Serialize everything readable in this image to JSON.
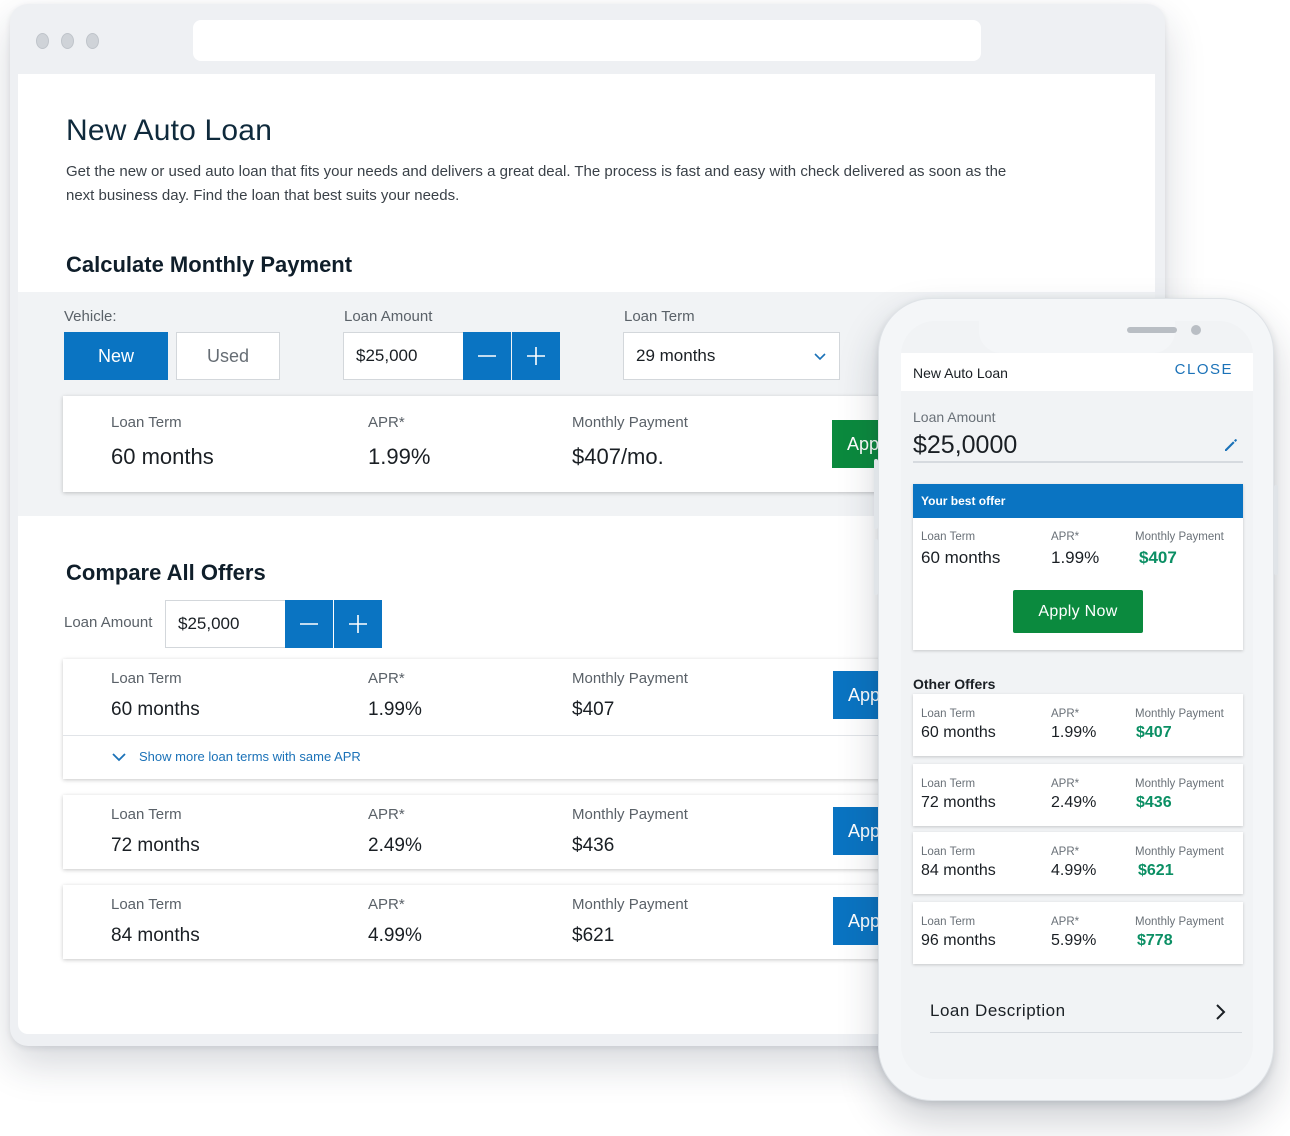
{
  "desktop": {
    "title": "New Auto Loan",
    "description": "Get the new or used auto loan that fits your needs and delivers a great deal. The process is fast and easy with check delivered as soon as the next business day. Find the loan that best suits your needs.",
    "calculator": {
      "heading": "Calculate Monthly Payment",
      "vehicle_label": "Vehicle:",
      "vehicle_options": [
        "New",
        "Used"
      ],
      "vehicle_selected": "New",
      "loan_amount_label": "Loan Amount",
      "loan_amount_value": "$25,000",
      "loan_term_label": "Loan Term",
      "loan_term_value": "29 months",
      "result": {
        "term_label": "Loan Term",
        "term_value": "60 months",
        "apr_label": "APR*",
        "apr_value": "1.99%",
        "payment_label": "Monthly Payment",
        "payment_value": "$407/mo.",
        "apply_label": "Apply"
      }
    },
    "compare": {
      "heading": "Compare All Offers",
      "loan_amount_label": "Loan Amount",
      "loan_amount_value": "$25,000",
      "show_more": "Show more loan terms with same APR",
      "offers": [
        {
          "term_label": "Loan Term",
          "term": "60 months",
          "apr_label": "APR*",
          "apr": "1.99%",
          "payment_label": "Monthly Payment",
          "payment": "$407",
          "apply": "Apply"
        },
        {
          "term_label": "Loan Term",
          "term": "72 months",
          "apr_label": "APR*",
          "apr": "2.49%",
          "payment_label": "Monthly Payment",
          "payment": "$436",
          "apply": "Apply"
        },
        {
          "term_label": "Loan Term",
          "term": "84 months",
          "apr_label": "APR*",
          "apr": "4.99%",
          "payment_label": "Monthly Payment",
          "payment": "$621",
          "apply": "Apply"
        }
      ]
    }
  },
  "mobile": {
    "title": "New Auto Loan",
    "close": "CLOSE",
    "loan_amount_label": "Loan Amount",
    "loan_amount_value": "$25,0000",
    "best_offer": {
      "header": "Your best offer",
      "term_label": "Loan Term",
      "term": "60 months",
      "apr_label": "APR*",
      "apr": "1.99%",
      "payment_label": "Monthly Payment",
      "payment": "$407",
      "apply": "Apply Now"
    },
    "other_offers_label": "Other Offers",
    "other_offers": [
      {
        "term_label": "Loan Term",
        "term": "60 months",
        "apr_label": "APR*",
        "apr": "1.99%",
        "payment_label": "Monthly Payment",
        "payment": "$407"
      },
      {
        "term_label": "Loan Term",
        "term": "72 months",
        "apr_label": "APR*",
        "apr": "2.49%",
        "payment_label": "Monthly Payment",
        "payment": "$436"
      },
      {
        "term_label": "Loan Term",
        "term": "84 months",
        "apr_label": "APR*",
        "apr": "4.99%",
        "payment_label": "Monthly Payment",
        "payment": "$621"
      },
      {
        "term_label": "Loan Term",
        "term": "96 months",
        "apr_label": "APR*",
        "apr": "5.99%",
        "payment_label": "Monthly Payment",
        "payment": "$778"
      }
    ],
    "loan_description": "Loan Description"
  },
  "colors": {
    "primary_blue": "#0a74c2",
    "apply_green": "#0b8a3e",
    "payment_green": "#0b8f64",
    "link_blue": "#1b72b8"
  }
}
